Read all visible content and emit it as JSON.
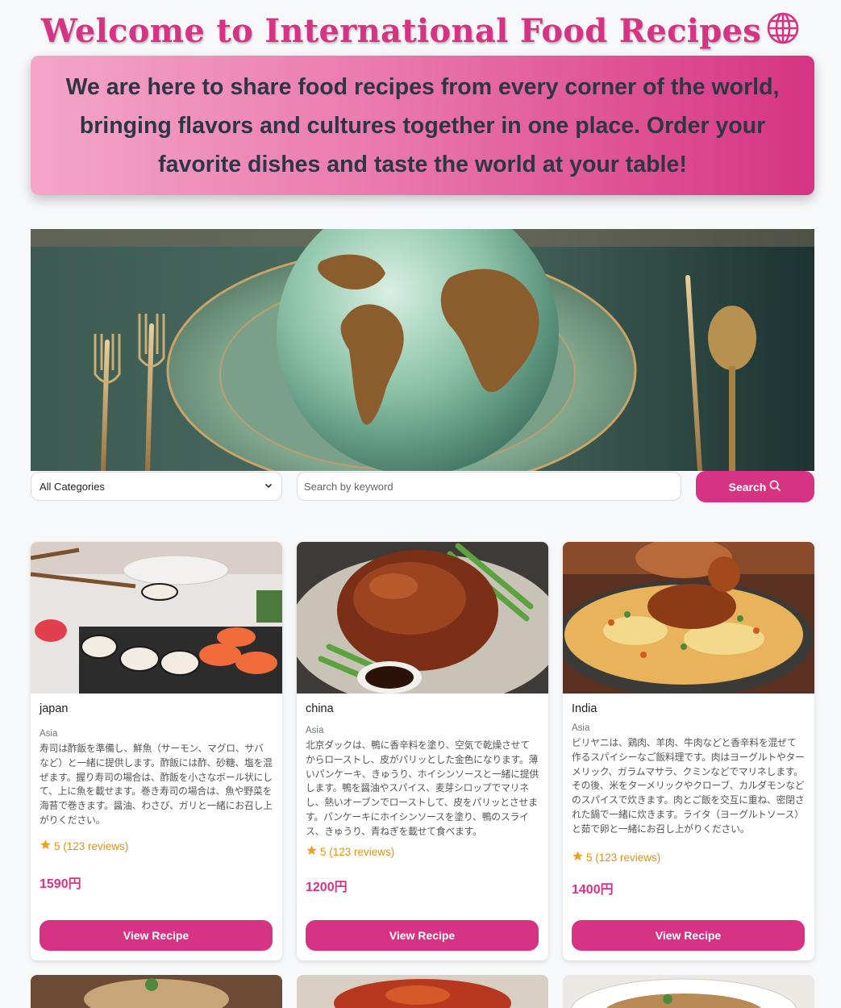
{
  "header": {
    "title": "Welcome to International Food Recipes",
    "title_icon": "globe-icon",
    "intro": "We are here to share food recipes from every corner of the world, bringing flavors and cultures together in one place. Order your favorite dishes and taste the world at your table!"
  },
  "colors": {
    "accent": "#d63384",
    "banner_start": "#f4a6c8",
    "banner_end": "#d63384",
    "star": "#f0a020"
  },
  "hero": {
    "image": "globe-on-plate-with-cutlery"
  },
  "filters": {
    "category_selected": "All Categories",
    "search_placeholder": "Search by keyword",
    "search_label": "Search",
    "search_icon": "magnifier-icon"
  },
  "recipes": [
    {
      "name": "japan",
      "region": "Asia",
      "image": "sushi-platter",
      "description": "寿司は酢飯を準備し、鮮魚（サーモン、マグロ、サバなど）と一緒に提供します。酢飯には酢、砂糖、塩を混ぜます。握り寿司の場合は、酢飯を小さなボール状にして、上に魚を載せます。巻き寿司の場合は、魚や野菜を海苔で巻きます。醤油、わさび、ガリと一緒にお召し上がりください。",
      "rating": "5 (123 reviews)",
      "stars": 1,
      "price": "1590円",
      "button": "View Recipe"
    },
    {
      "name": "china",
      "region": "Asia",
      "image": "peking-duck",
      "description": "北京ダックは、鴨に香辛料を塗り、空気で乾燥させてからローストし、皮がパリッとした金色になります。薄いパンケーキ、きゅうり、ホイシンソースと一緒に提供します。鴨を醤油やスパイス、麦芽シロップでマリネし、熱いオーブンでローストして、皮をパリッとさせます。パンケーキにホイシンソースを塗り、鴨のスライス、きゅうり、青ねぎを載せて食べます。",
      "rating": "5 (123 reviews)",
      "stars": 1,
      "price": "1200円",
      "button": "View Recipe"
    },
    {
      "name": "India",
      "region": "Asia",
      "image": "biryani",
      "description": "ビリヤニは、鶏肉、羊肉、牛肉などと香辛料を混ぜて作るスパイシーなご飯料理です。肉はヨーグルトやターメリック、ガラムマサラ、クミンなどでマリネします。その後、米をターメリックやクローブ、カルダモンなどのスパイスで炊きます。肉とご飯を交互に重ね、密閉された鍋で一緒に炊きます。ライタ（ヨーグルトソース）と茹で卵と一緒にお召し上がりください。",
      "rating": "5 (123 reviews)",
      "stars": 1,
      "price": "1400円",
      "button": "View Recipe"
    }
  ]
}
